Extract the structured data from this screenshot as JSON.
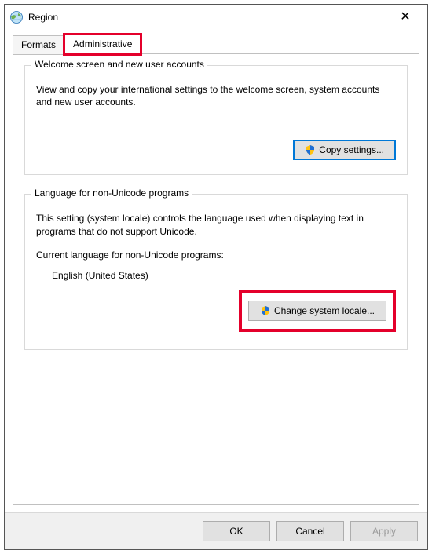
{
  "window": {
    "title": "Region"
  },
  "tabs": {
    "formats": "Formats",
    "administrative": "Administrative"
  },
  "group1": {
    "legend": "Welcome screen and new user accounts",
    "desc": "View and copy your international settings to the welcome screen, system accounts and new user accounts.",
    "button": "Copy settings..."
  },
  "group2": {
    "legend": "Language for non-Unicode programs",
    "desc": "This setting (system locale) controls the language used when displaying text in programs that do not support Unicode.",
    "current_label": "Current language for non-Unicode programs:",
    "current_value": "English (United States)",
    "button": "Change system locale..."
  },
  "buttons": {
    "ok": "OK",
    "cancel": "Cancel",
    "apply": "Apply"
  }
}
